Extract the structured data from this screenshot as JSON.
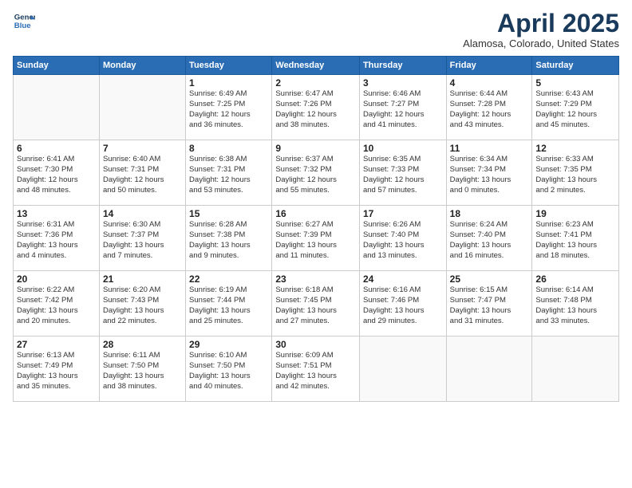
{
  "header": {
    "logo_line1": "General",
    "logo_line2": "Blue",
    "month": "April 2025",
    "location": "Alamosa, Colorado, United States"
  },
  "weekdays": [
    "Sunday",
    "Monday",
    "Tuesday",
    "Wednesday",
    "Thursday",
    "Friday",
    "Saturday"
  ],
  "weeks": [
    [
      {
        "day": "",
        "info": ""
      },
      {
        "day": "",
        "info": ""
      },
      {
        "day": "1",
        "info": "Sunrise: 6:49 AM\nSunset: 7:25 PM\nDaylight: 12 hours\nand 36 minutes."
      },
      {
        "day": "2",
        "info": "Sunrise: 6:47 AM\nSunset: 7:26 PM\nDaylight: 12 hours\nand 38 minutes."
      },
      {
        "day": "3",
        "info": "Sunrise: 6:46 AM\nSunset: 7:27 PM\nDaylight: 12 hours\nand 41 minutes."
      },
      {
        "day": "4",
        "info": "Sunrise: 6:44 AM\nSunset: 7:28 PM\nDaylight: 12 hours\nand 43 minutes."
      },
      {
        "day": "5",
        "info": "Sunrise: 6:43 AM\nSunset: 7:29 PM\nDaylight: 12 hours\nand 45 minutes."
      }
    ],
    [
      {
        "day": "6",
        "info": "Sunrise: 6:41 AM\nSunset: 7:30 PM\nDaylight: 12 hours\nand 48 minutes."
      },
      {
        "day": "7",
        "info": "Sunrise: 6:40 AM\nSunset: 7:31 PM\nDaylight: 12 hours\nand 50 minutes."
      },
      {
        "day": "8",
        "info": "Sunrise: 6:38 AM\nSunset: 7:31 PM\nDaylight: 12 hours\nand 53 minutes."
      },
      {
        "day": "9",
        "info": "Sunrise: 6:37 AM\nSunset: 7:32 PM\nDaylight: 12 hours\nand 55 minutes."
      },
      {
        "day": "10",
        "info": "Sunrise: 6:35 AM\nSunset: 7:33 PM\nDaylight: 12 hours\nand 57 minutes."
      },
      {
        "day": "11",
        "info": "Sunrise: 6:34 AM\nSunset: 7:34 PM\nDaylight: 13 hours\nand 0 minutes."
      },
      {
        "day": "12",
        "info": "Sunrise: 6:33 AM\nSunset: 7:35 PM\nDaylight: 13 hours\nand 2 minutes."
      }
    ],
    [
      {
        "day": "13",
        "info": "Sunrise: 6:31 AM\nSunset: 7:36 PM\nDaylight: 13 hours\nand 4 minutes."
      },
      {
        "day": "14",
        "info": "Sunrise: 6:30 AM\nSunset: 7:37 PM\nDaylight: 13 hours\nand 7 minutes."
      },
      {
        "day": "15",
        "info": "Sunrise: 6:28 AM\nSunset: 7:38 PM\nDaylight: 13 hours\nand 9 minutes."
      },
      {
        "day": "16",
        "info": "Sunrise: 6:27 AM\nSunset: 7:39 PM\nDaylight: 13 hours\nand 11 minutes."
      },
      {
        "day": "17",
        "info": "Sunrise: 6:26 AM\nSunset: 7:40 PM\nDaylight: 13 hours\nand 13 minutes."
      },
      {
        "day": "18",
        "info": "Sunrise: 6:24 AM\nSunset: 7:40 PM\nDaylight: 13 hours\nand 16 minutes."
      },
      {
        "day": "19",
        "info": "Sunrise: 6:23 AM\nSunset: 7:41 PM\nDaylight: 13 hours\nand 18 minutes."
      }
    ],
    [
      {
        "day": "20",
        "info": "Sunrise: 6:22 AM\nSunset: 7:42 PM\nDaylight: 13 hours\nand 20 minutes."
      },
      {
        "day": "21",
        "info": "Sunrise: 6:20 AM\nSunset: 7:43 PM\nDaylight: 13 hours\nand 22 minutes."
      },
      {
        "day": "22",
        "info": "Sunrise: 6:19 AM\nSunset: 7:44 PM\nDaylight: 13 hours\nand 25 minutes."
      },
      {
        "day": "23",
        "info": "Sunrise: 6:18 AM\nSunset: 7:45 PM\nDaylight: 13 hours\nand 27 minutes."
      },
      {
        "day": "24",
        "info": "Sunrise: 6:16 AM\nSunset: 7:46 PM\nDaylight: 13 hours\nand 29 minutes."
      },
      {
        "day": "25",
        "info": "Sunrise: 6:15 AM\nSunset: 7:47 PM\nDaylight: 13 hours\nand 31 minutes."
      },
      {
        "day": "26",
        "info": "Sunrise: 6:14 AM\nSunset: 7:48 PM\nDaylight: 13 hours\nand 33 minutes."
      }
    ],
    [
      {
        "day": "27",
        "info": "Sunrise: 6:13 AM\nSunset: 7:49 PM\nDaylight: 13 hours\nand 35 minutes."
      },
      {
        "day": "28",
        "info": "Sunrise: 6:11 AM\nSunset: 7:50 PM\nDaylight: 13 hours\nand 38 minutes."
      },
      {
        "day": "29",
        "info": "Sunrise: 6:10 AM\nSunset: 7:50 PM\nDaylight: 13 hours\nand 40 minutes."
      },
      {
        "day": "30",
        "info": "Sunrise: 6:09 AM\nSunset: 7:51 PM\nDaylight: 13 hours\nand 42 minutes."
      },
      {
        "day": "",
        "info": ""
      },
      {
        "day": "",
        "info": ""
      },
      {
        "day": "",
        "info": ""
      }
    ]
  ]
}
